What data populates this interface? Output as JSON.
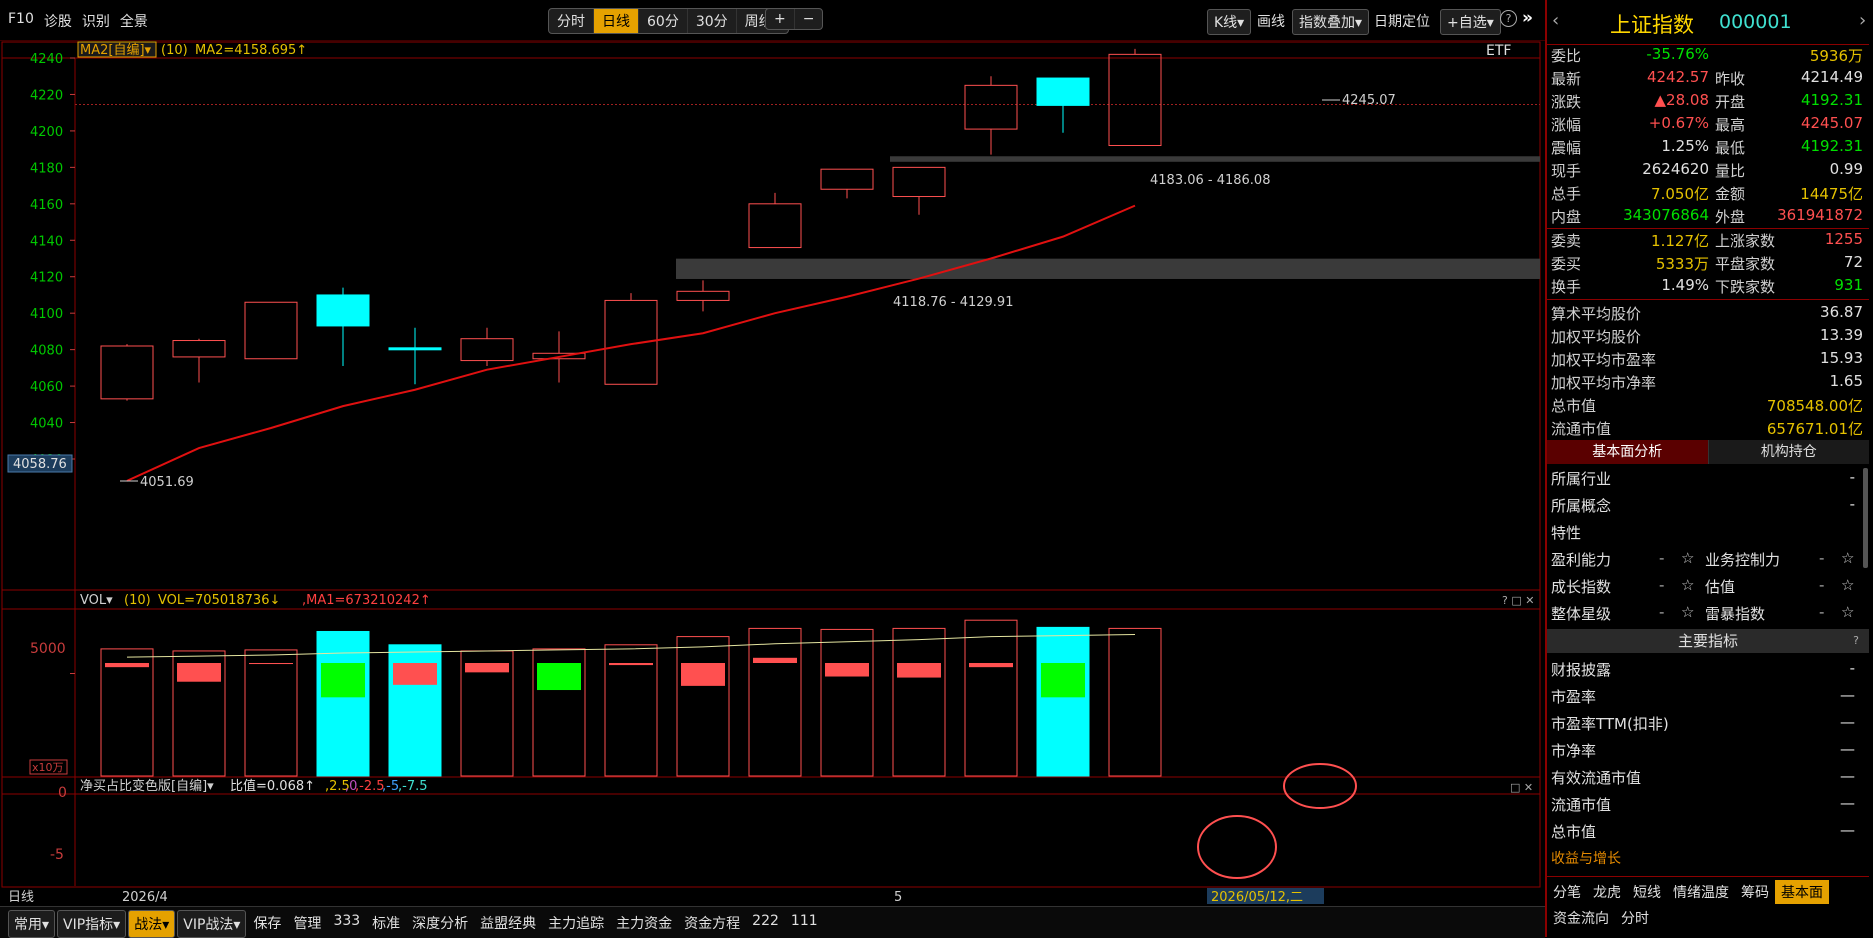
{
  "toolbar": {
    "left": [
      "F10",
      "诊股",
      "识别",
      "全景"
    ],
    "period_tabs": [
      "分时",
      "日线",
      "60分",
      "30分",
      "周线▾"
    ],
    "active_period": 1,
    "plus_label": "+",
    "minus_label": "−",
    "kline_label": "K线▾",
    "draw_label": "画线",
    "overlay_label": "指数叠加▾",
    "date_locate_label": "日期定位",
    "self_select_label": "+自选▾",
    "help_icon": "help-icon",
    "collapse_icon": "double-chevron-right-icon"
  },
  "main_chart": {
    "indicator_name": "MA2[自编]▾",
    "indicator_period": "(10)",
    "indicator_value": "MA2=4158.695↑",
    "etf_label": "ETF",
    "y_ticks": [
      "4240",
      "4220",
      "4200",
      "4180",
      "4160",
      "4140",
      "4120",
      "4100",
      "4080",
      "4060",
      "4040",
      "4020"
    ],
    "current_price_label": "4058.76",
    "high_label": "4245.07",
    "low_label": "4051.69",
    "gap_label_1": "4183.06 - 4186.08",
    "gap_label_2": "4118.76 - 4129.91"
  },
  "chart_data": [
    {
      "type": "candlestick",
      "title": "上证指数 日线",
      "ylim": [
        4005,
        4250
      ],
      "candles": [
        {
          "open": 4082,
          "close": 4053,
          "high": 4083,
          "low": 4052,
          "color": "red"
        },
        {
          "open": 4076,
          "close": 4085,
          "high": 4086,
          "low": 4062,
          "color": "red"
        },
        {
          "open": 4075,
          "close": 4106,
          "high": 4106,
          "low": 4075,
          "color": "red"
        },
        {
          "open": 4110,
          "close": 4093,
          "high": 4114,
          "low": 4071,
          "color": "cyan"
        },
        {
          "open": 4081,
          "close": 4080,
          "high": 4092,
          "low": 4061,
          "color": "cyan"
        },
        {
          "open": 4074,
          "close": 4086,
          "high": 4092,
          "low": 4071,
          "color": "red"
        },
        {
          "open": 4075,
          "close": 4078,
          "high": 4090,
          "low": 4062,
          "color": "red"
        },
        {
          "open": 4061,
          "close": 4107,
          "high": 4111,
          "low": 4061,
          "color": "red"
        },
        {
          "open": 4107,
          "close": 4112,
          "high": 4118,
          "low": 4101,
          "color": "red"
        },
        {
          "open": 4136,
          "close": 4160,
          "high": 4166,
          "low": 4136,
          "color": "red"
        },
        {
          "open": 4168,
          "close": 4179,
          "high": 4179,
          "low": 4163,
          "color": "red"
        },
        {
          "open": 4164,
          "close": 4180,
          "high": 4180,
          "low": 4154,
          "color": "red"
        },
        {
          "open": 4201,
          "close": 4225,
          "high": 4230,
          "low": 4187,
          "color": "red"
        },
        {
          "open": 4229,
          "close": 4214,
          "high": 4229,
          "low": 4199,
          "color": "cyan"
        },
        {
          "open": 4192,
          "close": 4242,
          "high": 4245,
          "low": 4192,
          "color": "red"
        }
      ],
      "ma_line": [
        4008,
        4026,
        4037,
        4049,
        4058,
        4069,
        4076,
        4083,
        4089,
        4100,
        4109,
        4119,
        4130,
        4142,
        4159
      ],
      "reference_line": 4214.49,
      "gaps": [
        {
          "from": 4183.06,
          "to": 4186.08
        },
        {
          "from": 4118.76,
          "to": 4129.91
        }
      ]
    },
    {
      "type": "bar",
      "title": "VOL",
      "ylim": [
        0,
        8000
      ],
      "values": [
        6200,
        6100,
        6150,
        7050,
        6400,
        6100,
        6200,
        6400,
        6800,
        7200,
        7150,
        7200,
        7600,
        7250,
        7200
      ],
      "colors": [
        "red",
        "red",
        "red",
        "cyan",
        "cyan",
        "red",
        "red",
        "red",
        "red",
        "red",
        "red",
        "red",
        "red",
        "cyan",
        "red"
      ],
      "ma_line": [
        5800,
        5850,
        5900,
        6000,
        6050,
        6100,
        6150,
        6200,
        6300,
        6450,
        6550,
        6650,
        6800,
        6850,
        6900
      ],
      "tick_label": "5000",
      "unit_label": "x10万"
    },
    {
      "type": "bar",
      "title": "净买占比变色版",
      "ylim": [
        -8,
        2
      ],
      "values": [
        -0.4,
        -1.8,
        -0.1,
        -3.3,
        -2.1,
        -0.9,
        -2.6,
        -0.2,
        -2.2,
        0.5,
        -1.3,
        -1.4,
        -0.4,
        -3.3,
        0
      ],
      "colors": [
        "red",
        "red",
        "red",
        "green",
        "red",
        "red",
        "green",
        "red",
        "red",
        "red",
        "red",
        "red",
        "red",
        "green",
        "red"
      ],
      "levels": [
        2.5,
        0,
        -2.5,
        -5,
        -7.5
      ],
      "tick_labels": [
        "0",
        "-5"
      ]
    }
  ],
  "vol_panel": {
    "header_name": "VOL▾",
    "header_period": "(10)",
    "header_value": "VOL=705018736↓",
    "header_ma": ",MA1=673210242↑",
    "tick_5000": "5000",
    "unit": "x10万"
  },
  "ind_panel": {
    "header_name": "净买占比变色版[自编]▾",
    "header_value": "比值=0.068↑",
    "levels_text": [
      ",2.5",
      ",0",
      ",-2.5",
      ",-5",
      ",-7.5"
    ],
    "tick_0": "0",
    "tick_m5": "-5"
  },
  "x_axis": {
    "period_label": "日线",
    "start_date": "2026/4",
    "mid_label": "5",
    "cursor_date": "2026/05/12,二"
  },
  "bottom": {
    "items": [
      "常用▾",
      "VIP指标▾",
      "战法▾",
      "VIP战法▾",
      "保存",
      "管理",
      "333",
      "标准",
      "深度分析",
      "益盟经典",
      "主力追踪",
      "主力资金",
      "资金方程",
      "222",
      "111"
    ],
    "active": 2
  },
  "quote": {
    "name": "上证指数",
    "code": "000001",
    "rows_a": [
      {
        "l": "委比",
        "v": "-35.76%",
        "c": "grn",
        "r": "5936万",
        "rc": "yel"
      }
    ],
    "rows": [
      {
        "l": "最新",
        "v": "4242.57",
        "c": "red",
        "l2": "昨收",
        "v2": "4214.49",
        "c2": "wht"
      },
      {
        "l": "涨跌",
        "v": "▲28.08",
        "c": "red",
        "l2": "开盘",
        "v2": "4192.31",
        "c2": "grn"
      },
      {
        "l": "涨幅",
        "v": "+0.67%",
        "c": "red",
        "l2": "最高",
        "v2": "4245.07",
        "c2": "red"
      },
      {
        "l": "震幅",
        "v": "1.25%",
        "c": "wht",
        "l2": "最低",
        "v2": "4192.31",
        "c2": "grn"
      },
      {
        "l": "现手",
        "v": "2624620",
        "c": "wht",
        "l2": "量比",
        "v2": "0.99",
        "c2": "wht"
      },
      {
        "l": "总手",
        "v": "7.050亿",
        "c": "yel",
        "l2": "金额",
        "v2": "14475亿",
        "c2": "yel"
      },
      {
        "l": "内盘",
        "v": "343076864",
        "c": "grn",
        "l2": "外盘",
        "v2": "361941872",
        "c2": "red"
      }
    ],
    "rows2": [
      {
        "l": "委卖",
        "v": "1.127亿",
        "c": "yel",
        "l2": "上涨家数",
        "v2": "1255",
        "c2": "red"
      },
      {
        "l": "委买",
        "v": "5333万",
        "c": "yel",
        "l2": "平盘家数",
        "v2": "72",
        "c2": "wht"
      },
      {
        "l": "换手",
        "v": "1.49%",
        "c": "wht",
        "l2": "下跌家数",
        "v2": "931",
        "c2": "grn"
      }
    ],
    "rows3": [
      {
        "l": "算术平均股价",
        "v": "36.87",
        "c": "wht"
      },
      {
        "l": "加权平均股价",
        "v": "13.39",
        "c": "wht"
      },
      {
        "l": "加权平均市盈率",
        "v": "15.93",
        "c": "wht"
      },
      {
        "l": "加权平均市净率",
        "v": "1.65",
        "c": "wht"
      },
      {
        "l": "总市值",
        "v": "708548.00亿",
        "c": "yel"
      },
      {
        "l": "流通市值",
        "v": "657671.01亿",
        "c": "yel"
      }
    ],
    "tabs": [
      "基本面分析",
      "机构持仓"
    ],
    "industry_label": "所属行业",
    "industry_value": "-",
    "concept_label": "所属概念",
    "concept_value": "-",
    "feature_label": "特性",
    "features": [
      {
        "l": "盈利能力",
        "v": "-",
        "l2": "业务控制力",
        "v2": "-"
      },
      {
        "l": "成长指数",
        "v": "-",
        "l2": "估值",
        "v2": "-"
      },
      {
        "l": "整体星级",
        "v": "-",
        "l2": "雷暴指数",
        "v2": "-"
      }
    ],
    "main_indicators_title": "主要指标",
    "main_q": "?",
    "indicators": [
      {
        "l": "财报披露",
        "v": "-"
      },
      {
        "l": "市盈率",
        "v": "—"
      },
      {
        "l": "市盈率TTM(扣非)",
        "v": "—"
      },
      {
        "l": "市净率",
        "v": "—"
      },
      {
        "l": "有效流通市值",
        "v": "—"
      },
      {
        "l": "流通市值",
        "v": "—"
      },
      {
        "l": "总市值",
        "v": "—"
      }
    ],
    "growth_label": "收益与增长",
    "bottom_tabs": [
      "分笔",
      "龙虎",
      "短线",
      "情绪温度",
      "筹码",
      "基本面"
    ],
    "bottom_tabs_active": 5,
    "bottom_tabs2": [
      "资金流向",
      "分时"
    ]
  }
}
